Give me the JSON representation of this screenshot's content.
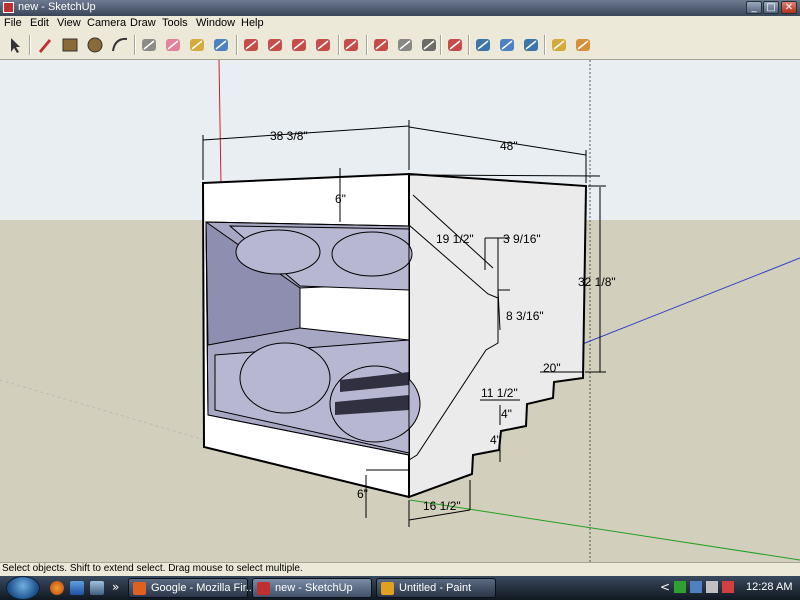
{
  "window": {
    "title": "new - SketchUp",
    "minimize": "_",
    "maximize": "□",
    "close": "✕"
  },
  "menu": [
    "File",
    "Edit",
    "View",
    "Camera",
    "Draw",
    "Tools",
    "Window",
    "Help"
  ],
  "toolbar": {
    "tools": [
      {
        "name": "select-tool-icon",
        "color": "#333333"
      },
      {
        "name": "pencil-tool-icon",
        "color": "#c03030"
      },
      {
        "name": "rectangle-tool-icon",
        "color": "#8b6a3a"
      },
      {
        "name": "circle-tool-icon",
        "color": "#8b6a3a"
      },
      {
        "name": "arc-tool-icon",
        "color": "#333333"
      },
      {
        "name": "make-component-icon",
        "color": "#7a7a7a"
      },
      {
        "name": "eraser-tool-icon",
        "color": "#e07090"
      },
      {
        "name": "tape-measure-icon",
        "color": "#d0a020"
      },
      {
        "name": "paint-bucket-icon",
        "color": "#3070c0"
      },
      {
        "name": "push-pull-icon",
        "color": "#c03030"
      },
      {
        "name": "move-tool-icon",
        "color": "#c03030"
      },
      {
        "name": "rotate-tool-icon",
        "color": "#c03030"
      },
      {
        "name": "follow-me-icon",
        "color": "#c03030"
      },
      {
        "name": "offset-tool-icon",
        "color": "#c03030"
      },
      {
        "name": "orbit-tool-icon",
        "color": "#c03030"
      },
      {
        "name": "pan-hand-icon",
        "color": "#777777"
      },
      {
        "name": "zoom-tool-icon",
        "color": "#555555"
      },
      {
        "name": "zoom-extents-icon",
        "color": "#c03030"
      },
      {
        "name": "get-models-icon",
        "color": "#2060a0"
      },
      {
        "name": "share-model-icon",
        "color": "#3070c0"
      },
      {
        "name": "google-earth-icon",
        "color": "#2060a0"
      },
      {
        "name": "get-current-view-icon",
        "color": "#d0a020"
      },
      {
        "name": "toggle-terrain-icon",
        "color": "#d08020"
      }
    ]
  },
  "dimensions": [
    "38 3/8\"",
    "48\"",
    "6\"",
    "19 1/2\"",
    "3 9/16\"",
    "32 1/8\"",
    "8 3/16\"",
    "20\"",
    "11 1/2\"",
    "4\"",
    "4\"",
    "6\"",
    "16 1/2\""
  ],
  "status": "Select objects. Shift to extend select. Drag mouse to select multiple.",
  "taskbar": {
    "quick_launch": [
      "firefox-icon",
      "media-icon",
      "show-desktop-icon"
    ],
    "more": "»",
    "tasks": [
      {
        "label": "Google - Mozilla Fir...",
        "icon_color": "#e06020"
      },
      {
        "label": "new - SketchUp",
        "icon_color": "#c03030"
      },
      {
        "label": "Untitled - Paint",
        "icon_color": "#e0a020"
      }
    ],
    "clock": "12:28 AM",
    "tray_arrow": "<"
  },
  "colors": {
    "sky": "#e9eef2",
    "ground": "#d2cfbd",
    "box_face": "#ffffff",
    "box_inner": "#a7a7c4",
    "box_shadow": "#8e8eb0",
    "axis_red": "#d02020",
    "axis_green": "#20a020",
    "axis_blue": "#3040c0"
  }
}
